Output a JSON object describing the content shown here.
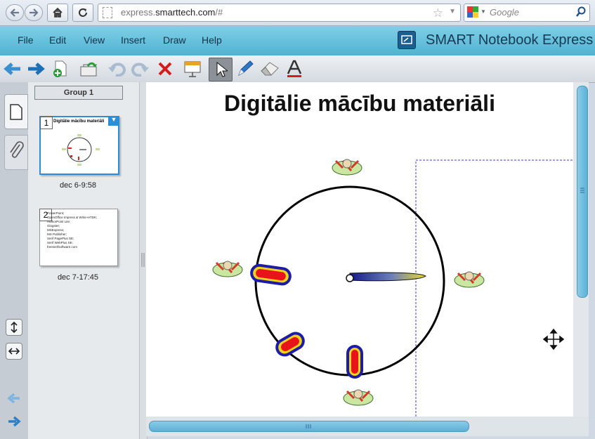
{
  "browser": {
    "url_host": "express.",
    "url_domain": "smarttech.com",
    "url_path": "/#",
    "search_placeholder": "Google",
    "icons": [
      "back-icon",
      "forward-icon",
      "home-icon",
      "reload-icon",
      "page-icon",
      "star-icon",
      "google-icon",
      "search-icon"
    ]
  },
  "app": {
    "menu": [
      "File",
      "Edit",
      "View",
      "Insert",
      "Draw",
      "Help"
    ],
    "title": "SMART Notebook Express",
    "colors": {
      "header": "#5bbcd9",
      "accent": "#1a5f92"
    }
  },
  "toolbar": {
    "tools": [
      "previous-page",
      "next-page",
      "add-page",
      "open-file",
      "undo",
      "redo",
      "delete",
      "show-screen-shade",
      "select",
      "pen",
      "eraser",
      "text"
    ]
  },
  "sorter": {
    "group_label": "Group 1",
    "pages": [
      {
        "number": "1",
        "label": "dec 6-9:58",
        "thumb_title": "Digitālie mācību materiāli"
      },
      {
        "number": "2",
        "label": "dec 7-17:45",
        "thumb_lines": [
          "PowerPoint;",
          "OpenOffice Impress & Write+eTDK;",
          "AuthorPoint Lite;",
          "Glogster;",
          "MSExpress;",
          "MS Publisher;",
          "Serif PagePlus SE;",
          "Serif WebPlus SE;",
          "freeserifsoftware.com"
        ]
      }
    ]
  },
  "canvas": {
    "title": "Digitālie mācību materiāli"
  }
}
